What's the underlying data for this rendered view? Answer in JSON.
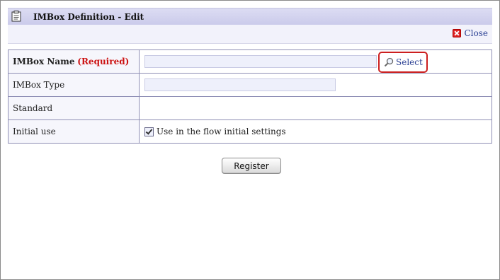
{
  "dialog": {
    "title": "IMBox Definition - Edit",
    "close_label": "Close"
  },
  "form": {
    "name": {
      "label": "IMBox Name",
      "required_mark": "(Required)",
      "value": "",
      "select_label": "Select"
    },
    "type": {
      "label": "IMBox Type",
      "value": ""
    },
    "standard": {
      "label": "Standard",
      "value": ""
    },
    "initial_use": {
      "label": "Initial use",
      "checkbox_label": "Use in the flow initial settings",
      "checked": true
    }
  },
  "actions": {
    "register_label": "Register"
  },
  "colors": {
    "title_bar": "#cacaea",
    "link": "#2a3f93",
    "required": "#cc1111",
    "highlight_border": "#cc1f1f"
  }
}
